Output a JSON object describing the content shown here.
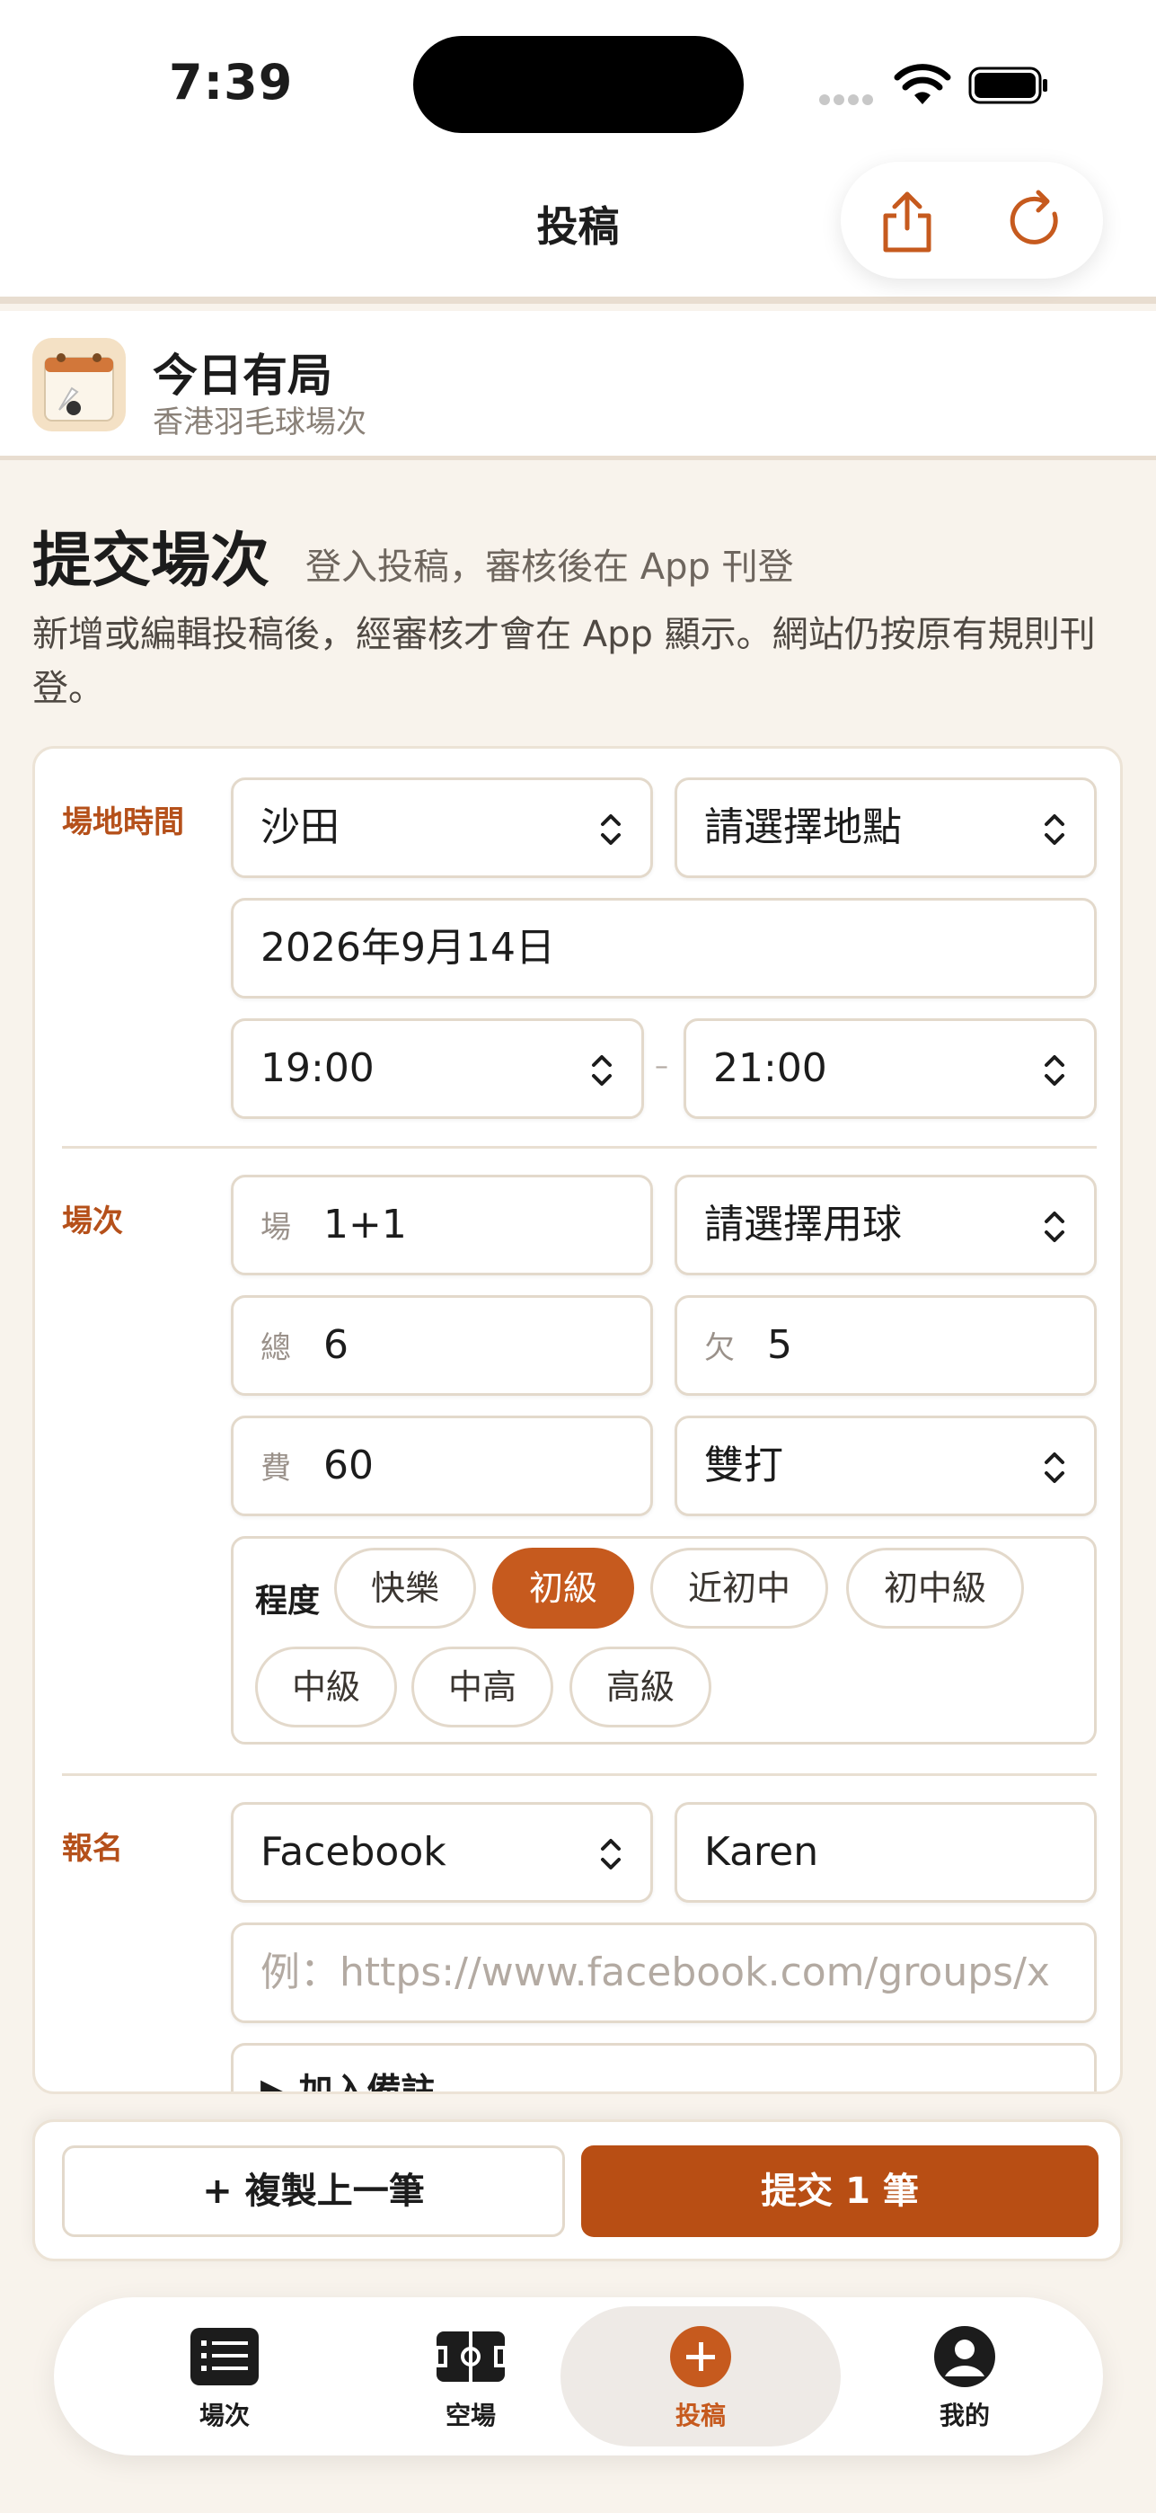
{
  "status_bar": {
    "time": "7:39"
  },
  "header": {
    "title": "投稿",
    "share_icon": "share-icon",
    "refresh_icon": "refresh-icon"
  },
  "brand": {
    "name": "今日有局",
    "subtitle": "香港羽毛球場次"
  },
  "intro": {
    "title": "提交場次",
    "subtitle": "登入投稿，審核後在 App 刊登",
    "description": "新增或編輯投稿後，經審核才會在 App 顯示。網站仍按原有規則刊登。"
  },
  "venue_time": {
    "label": "場地時間",
    "district": "沙田",
    "location_placeholder": "請選擇地點",
    "date": "2026年9月14日",
    "start_time": "19:00",
    "time_separator": "–",
    "end_time": "21:00"
  },
  "session": {
    "label": "場次",
    "courts_prefix": "場",
    "courts_value": "1+1",
    "shuttle_placeholder": "請選擇用球",
    "total_prefix": "總",
    "total_value": "6",
    "missing_prefix": "欠",
    "missing_value": "5",
    "fee_prefix": "費",
    "fee_value": "60",
    "play_type": "雙打",
    "level_label": "程度",
    "levels": [
      "快樂",
      "初級",
      "近初中",
      "初中級",
      "中級",
      "中高",
      "高級"
    ],
    "selected_level": "初級"
  },
  "signup": {
    "label": "報名",
    "platform": "Facebook",
    "contact_name": "Karen",
    "url_placeholder": "例：https://www.facebook.com/groups/x",
    "add_note_label": "▶ 加入備註"
  },
  "actions": {
    "copy_label": "+ 複製上一筆",
    "submit_label": "提交 1 筆"
  },
  "tabs": [
    {
      "label": "場次",
      "icon": "list-icon"
    },
    {
      "label": "空場",
      "icon": "court-icon"
    },
    {
      "label": "投稿",
      "icon": "plus-circle-icon",
      "active": true
    },
    {
      "label": "我的",
      "icon": "profile-icon"
    }
  ],
  "colors": {
    "accent": "#c65a1e",
    "accent_dark": "#b84e14",
    "background": "#f8f3ec",
    "border": "#e3d9cb"
  }
}
